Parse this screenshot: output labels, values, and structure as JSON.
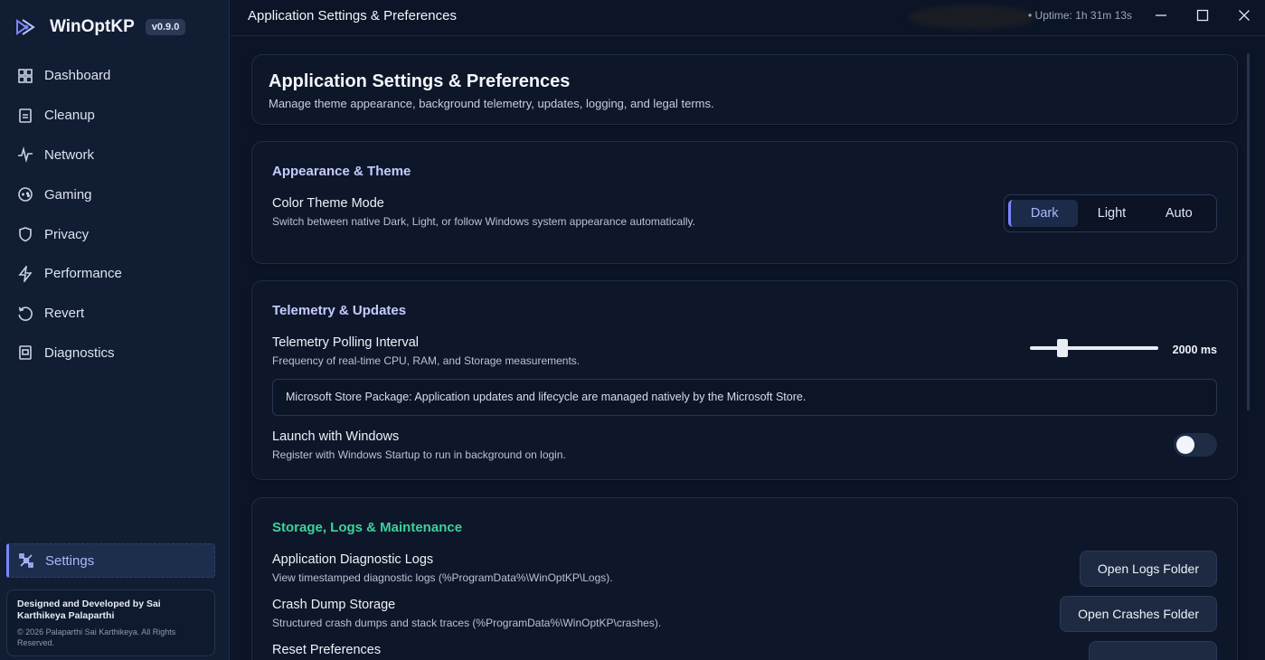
{
  "app": {
    "name": "WinOptKP",
    "version": "v0.9.0"
  },
  "sidebar": {
    "items": [
      {
        "label": "Dashboard",
        "icon": "dashboard-icon"
      },
      {
        "label": "Cleanup",
        "icon": "cleanup-icon"
      },
      {
        "label": "Network",
        "icon": "network-icon"
      },
      {
        "label": "Gaming",
        "icon": "gaming-icon"
      },
      {
        "label": "Privacy",
        "icon": "shield-icon"
      },
      {
        "label": "Performance",
        "icon": "bolt-icon"
      },
      {
        "label": "Revert",
        "icon": "revert-icon"
      },
      {
        "label": "Diagnostics",
        "icon": "diagnostics-icon"
      }
    ],
    "active": {
      "label": "Settings",
      "icon": "settings-icon"
    },
    "credit": {
      "title": "Designed and Developed by Sai Karthikeya Palaparthi",
      "copyright": "© 2026 Palaparthi Sai Karthikeya. All Rights Reserved."
    }
  },
  "titlebar": {
    "title": "Application Settings & Preferences",
    "uptime": "• Uptime: 1h 31m 13s"
  },
  "header": {
    "title": "Application Settings & Preferences",
    "subtitle": "Manage theme appearance, background telemetry, updates, logging, and legal terms."
  },
  "appearance": {
    "section_title": "Appearance & Theme",
    "theme_title": "Color Theme Mode",
    "theme_desc": "Switch between native Dark, Light, or follow Windows system appearance automatically.",
    "options": [
      "Dark",
      "Light",
      "Auto"
    ],
    "selected": "Dark"
  },
  "telemetry": {
    "section_title": "Telemetry & Updates",
    "polling_title": "Telemetry Polling Interval",
    "polling_desc": "Frequency of real-time CPU, RAM, and Storage measurements.",
    "polling_value": "2000 ms",
    "slider_fraction": 0.25,
    "store_note": "Microsoft Store Package: Application updates and lifecycle are managed natively by the Microsoft Store.",
    "launch_title": "Launch with Windows",
    "launch_desc": "Register with Windows Startup to run in background on login.",
    "launch_enabled": false
  },
  "storage": {
    "section_title": "Storage, Logs & Maintenance",
    "logs_title": "Application Diagnostic Logs",
    "logs_desc": "View timestamped diagnostic logs (%ProgramData%\\WinOptKP\\Logs).",
    "logs_button": "Open Logs Folder",
    "crash_title": "Crash Dump Storage",
    "crash_desc": "Structured crash dumps and stack traces (%ProgramData%\\WinOptKP\\crashes).",
    "crash_button": "Open Crashes Folder",
    "reset_title": "Reset Preferences"
  },
  "colors": {
    "accent": "#7c86ff",
    "storage_heading": "#3fd19a",
    "section_heading": "#c6ccff",
    "background": "#0c1527"
  }
}
